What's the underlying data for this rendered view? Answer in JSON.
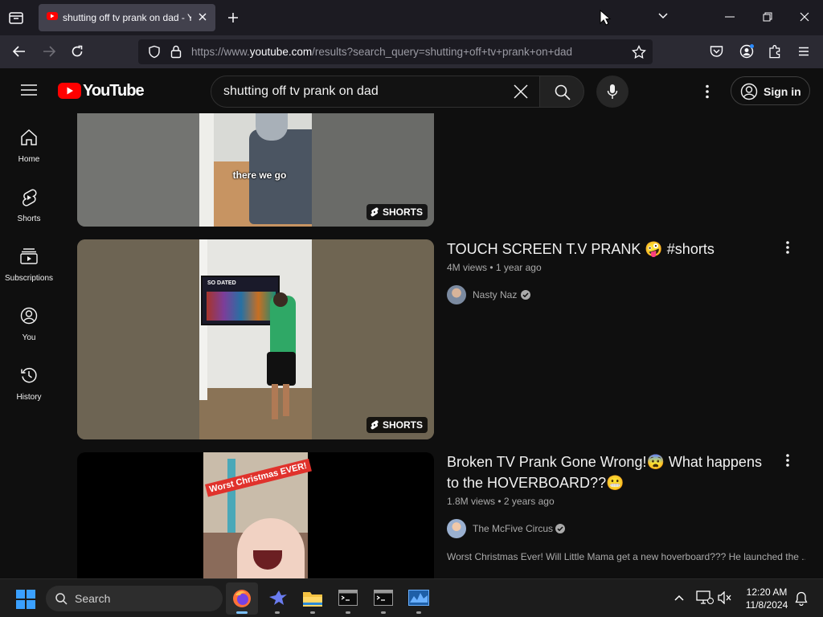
{
  "browser": {
    "tab_title": "shutting off tv prank on dad - YouTube",
    "url_prefix": "https://www.",
    "url_domain": "youtube.com",
    "url_path": "/results?search_query=shutting+off+tv+prank+on+dad"
  },
  "youtube": {
    "logo_text": "YouTube",
    "search_value": "shutting off tv prank on dad",
    "signin_label": "Sign in",
    "sidebar": [
      {
        "label": "Home",
        "icon": "home-icon"
      },
      {
        "label": "Shorts",
        "icon": "shorts-icon"
      },
      {
        "label": "Subscriptions",
        "icon": "subscriptions-icon"
      },
      {
        "label": "You",
        "icon": "you-icon"
      },
      {
        "label": "History",
        "icon": "history-icon"
      }
    ],
    "results": [
      {
        "caption": "there we go",
        "badge": "SHORTS"
      },
      {
        "title": "TOUCH SCREEN T.V PRANK 🤪 #shorts",
        "views": "4M views",
        "age": "1 year ago",
        "channel": "Nasty Naz",
        "badge": "SHORTS",
        "tv_label": "SO DATED"
      },
      {
        "title": "Broken TV Prank Gone Wrong!😨 What happens to the HOVERBOARD??😬",
        "views": "1.8M views",
        "age": "2 years ago",
        "channel": "The McFive Circus",
        "description": "Worst Christmas Ever! Will Little Mama get a new hoverboard??? He launched the ...",
        "overlay": "Worst Christmas EVER!"
      }
    ],
    "meta_separator": "•"
  },
  "taskbar": {
    "search_placeholder": "Search",
    "time": "12:20 AM",
    "date": "11/8/2024"
  },
  "colors": {
    "youtube_red": "#ff0000",
    "background": "#0f0f0f",
    "meta_text": "#aaaaaa"
  }
}
